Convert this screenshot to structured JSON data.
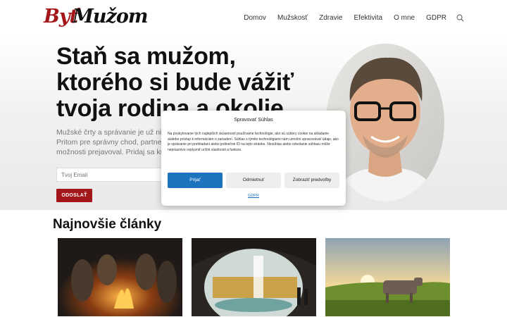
{
  "logo": {
    "part1": "Byť",
    "part2": "Mužom"
  },
  "nav": {
    "items": [
      "Domov",
      "Mužskosť",
      "Zdravie",
      "Efektivita",
      "O mne",
      "GDPR"
    ],
    "search_icon": "search-icon"
  },
  "hero": {
    "title": "Staň sa mužom, ktorého si bude vážiť tvoja rodina a okolie",
    "subtitle_lines": [
      "Mužské črty a správanie je už nieko",
      "Pritom pre správny chod, partnerka,",
      "možnosti prejavoval. Pridaj sa ku m"
    ],
    "email_placeholder": "Tvoj Email",
    "send_label": "ODOSLAŤ"
  },
  "articles": {
    "heading": "Najnovšie články"
  },
  "consent": {
    "title": "Spravovať Súhlas",
    "text": "Na poskytovanie tých najlepších skúseností používame technológie, ako sú súbory cookie na ukladanie a/alebo prístup k informáciám o zariadení. Súhlas s týmito technológiami nám umožní spracovávať údaje, ako je správanie pri prehliadaní alebo jedinečné ID na tejto stránke. Nesúhlas alebo odvolanie súhlasu môže nepriaznivo ovplyvniť určité vlastnosti a funkcie.",
    "accept_label": "Prijať",
    "deny_label": "Odmietnuť",
    "prefs_label": "Zobraziť predvoľby",
    "gdpr_link": "GDPR"
  },
  "colors": {
    "brand": "#a3161a",
    "accept": "#1e73be"
  }
}
